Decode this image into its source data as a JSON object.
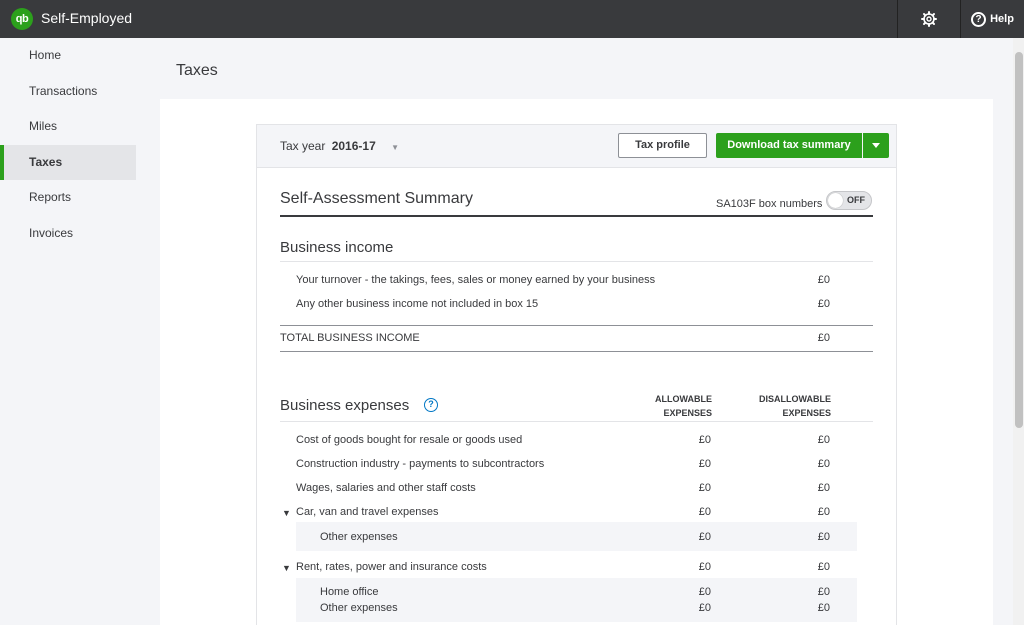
{
  "app": {
    "logo_text": "qb",
    "title": "Self-Employed",
    "help_label": "Help"
  },
  "sidebar": {
    "items": [
      {
        "label": "Home"
      },
      {
        "label": "Transactions"
      },
      {
        "label": "Miles"
      },
      {
        "label": "Taxes"
      },
      {
        "label": "Reports"
      },
      {
        "label": "Invoices"
      }
    ],
    "active": "Taxes"
  },
  "page": {
    "title": "Taxes"
  },
  "toolbar": {
    "tax_year_label": "Tax year",
    "tax_year_value": "2016-17",
    "tax_profile_label": "Tax profile",
    "download_label": "Download tax summary"
  },
  "summary": {
    "title": "Self-Assessment Summary",
    "sa_label": "SA103F box numbers",
    "toggle_state": "OFF"
  },
  "income": {
    "title": "Business income",
    "rows": [
      {
        "label": "Your turnover - the takings, fees, sales or money earned by your business",
        "amount": "£0"
      },
      {
        "label": "Any other business income not included in box 15",
        "amount": "£0"
      }
    ],
    "total": {
      "label": "TOTAL BUSINESS INCOME",
      "amount": "£0"
    }
  },
  "expenses": {
    "title": "Business expenses",
    "col_allowable": [
      "ALLOWABLE",
      "EXPENSES"
    ],
    "col_disallowable": [
      "DISALLOWABLE",
      "EXPENSES"
    ],
    "rows": [
      {
        "label": "Cost of goods bought for resale or goods used",
        "allowable": "£0",
        "disallowable": "£0"
      },
      {
        "label": "Construction industry - payments to subcontractors",
        "allowable": "£0",
        "disallowable": "£0"
      },
      {
        "label": "Wages, salaries and other staff costs",
        "allowable": "£0",
        "disallowable": "£0"
      },
      {
        "label": "Car, van and travel expenses",
        "allowable": "£0",
        "disallowable": "£0",
        "expanded": true,
        "children": [
          {
            "label": "Other expenses",
            "allowable": "£0",
            "disallowable": "£0"
          }
        ]
      },
      {
        "label": "Rent, rates, power and insurance costs",
        "allowable": "£0",
        "disallowable": "£0",
        "expanded": true,
        "children": [
          {
            "label": "Home office",
            "allowable": "£0",
            "disallowable": "£0"
          },
          {
            "label": "Other expenses",
            "allowable": "£0",
            "disallowable": "£0"
          }
        ]
      }
    ]
  },
  "colors": {
    "brand_green": "#2ca01c",
    "topbar": "#393a3d",
    "link_blue": "#0077c5"
  }
}
